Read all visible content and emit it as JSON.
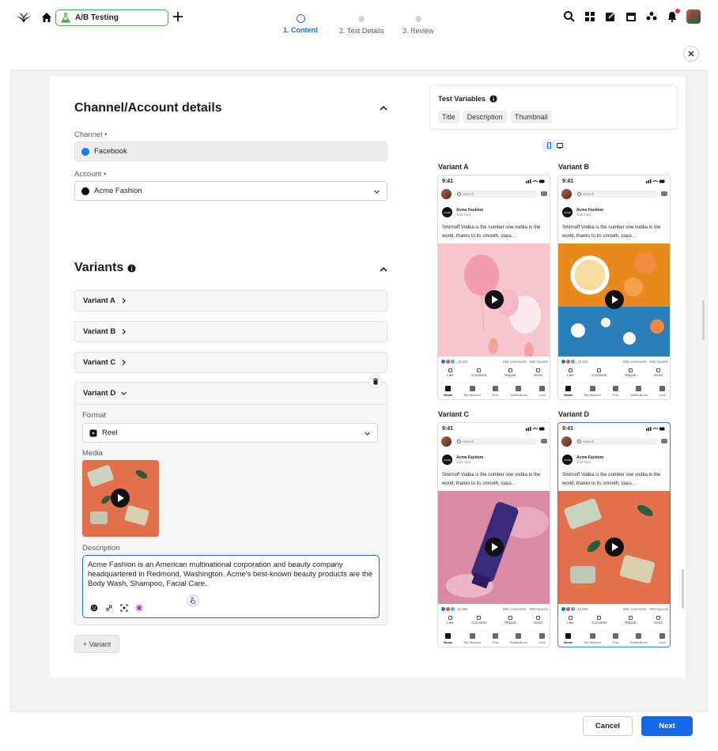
{
  "app": {
    "active_tab_label": "A/B Testing"
  },
  "stepper": {
    "steps": [
      {
        "label": "1. Content"
      },
      {
        "label": "2. Test Details"
      },
      {
        "label": "3. Review"
      }
    ],
    "current_step_index": 0
  },
  "form": {
    "channel_section_title": "Channel/Account details",
    "channel_label": "Channel",
    "channel_value": "Facebook",
    "account_label": "Account",
    "account_value": "Acme Fashion",
    "variants_title": "Variants",
    "variants": [
      {
        "label": "Variant A"
      },
      {
        "label": "Variant B"
      },
      {
        "label": "Variant C"
      },
      {
        "label": "Variant D"
      }
    ],
    "format_label": "Format",
    "format_value": "Reel",
    "media_label": "Media",
    "description_label": "Description",
    "description_value": "Acme Fashion is an American multinational corporation and beauty company headquartered in Redmond, Washington. Acme's best-known beauty products are the Body Wash, Shampoo, Facial Care.",
    "add_variant_label": "+ Variant"
  },
  "preview": {
    "test_variables_title": "Test Variables",
    "test_variables": [
      "Title",
      "Description",
      "Thumbnail"
    ],
    "phones": [
      {
        "variant_label": "Variant A",
        "media": "balloons"
      },
      {
        "variant_label": "Variant B",
        "media": "breakfast"
      },
      {
        "variant_label": "Variant C",
        "media": "tube"
      },
      {
        "variant_label": "Variant D",
        "media": "soap"
      }
    ],
    "phone_common": {
      "time": "9:41",
      "search_placeholder": "Search",
      "account_name": "Acme Fashion",
      "account_sub": "Just Now",
      "account_logo_text": "ACME",
      "post_text": "Smirnoff Vodka is the number one vodka in the world, thanks to its smooth, class...",
      "reactions_count": "10,691",
      "comments": "566 comments",
      "reposts": "930 reposts",
      "actions": [
        "Like",
        "Comment",
        "Repost",
        "Send"
      ],
      "nav": [
        "Home",
        "My Network",
        "Post",
        "Notifications",
        "Jobs"
      ]
    }
  },
  "footer": {
    "cancel_label": "Cancel",
    "next_label": "Next"
  },
  "colors": {
    "primary": "#1768e6",
    "active_tab_border": "#4caf50",
    "required": "#d32f2f"
  }
}
